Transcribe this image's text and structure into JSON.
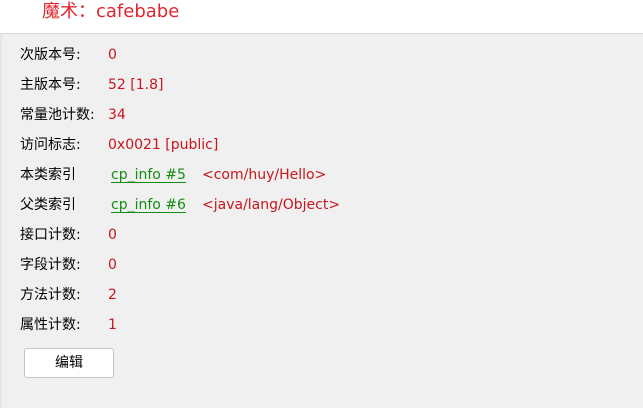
{
  "header": {
    "magic": "魔术：cafebabe"
  },
  "fields": {
    "minor_version": {
      "label": "次版本号:",
      "value": "0"
    },
    "major_version": {
      "label": "主版本号:",
      "value": "52 [1.8]"
    },
    "constant_pool_count": {
      "label": "常量池计数:",
      "value": "34"
    },
    "access_flags": {
      "label": "访问标志:",
      "value": "0x0021 [public]"
    },
    "this_class": {
      "label": "本类索引",
      "link": "cp_info #5",
      "ref": "<com/huy/Hello>"
    },
    "super_class": {
      "label": "父类索引",
      "link": "cp_info #6",
      "ref": "<java/lang/Object>"
    },
    "interfaces_count": {
      "label": "接口计数:",
      "value": "0"
    },
    "fields_count": {
      "label": "字段计数:",
      "value": "0"
    },
    "methods_count": {
      "label": "方法计数:",
      "value": "2"
    },
    "attributes_count": {
      "label": "属性计数:",
      "value": "1"
    }
  },
  "actions": {
    "edit_label": "编辑"
  },
  "colors": {
    "value_red": "#c8161d",
    "link_green": "#128c12",
    "panel_bg": "#f0f0f0"
  }
}
